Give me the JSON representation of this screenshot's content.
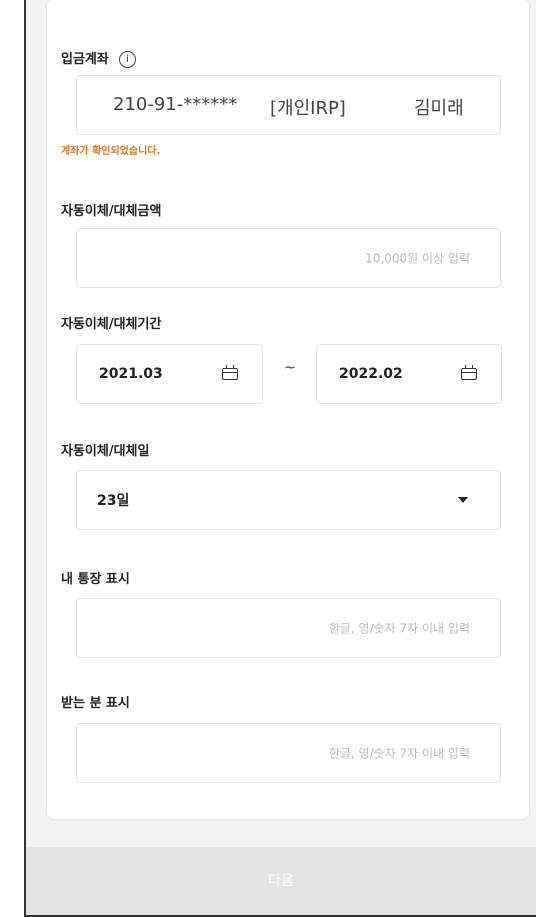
{
  "deposit_account": {
    "label": "입금계좌",
    "info_icon": "info-icon",
    "number": "210-91-******",
    "type": "[개인IRP]",
    "holder": "김미래",
    "confirm_message": "계좌가 확인되었습니다."
  },
  "amount": {
    "label": "자동이체/대체금액",
    "placeholder": "10,000원 이상 입력"
  },
  "period": {
    "label": "자동이체/대체기간",
    "start": "2021.03",
    "separator": "~",
    "end": "2022.02"
  },
  "day": {
    "label": "자동이체/대체일",
    "value": "23일"
  },
  "my_passbook": {
    "label": "내 통장 표시",
    "placeholder": "한글, 영/숫자 7자 이내 입력"
  },
  "recipient_passbook": {
    "label": "받는 분 표시",
    "placeholder": "한글, 영/숫자 7자 이내 입력"
  },
  "next_button": {
    "label": "다음"
  },
  "colors": {
    "confirm": "#e8781a",
    "button_bg": "#e4e4e4",
    "placeholder": "#bdbdbd"
  }
}
